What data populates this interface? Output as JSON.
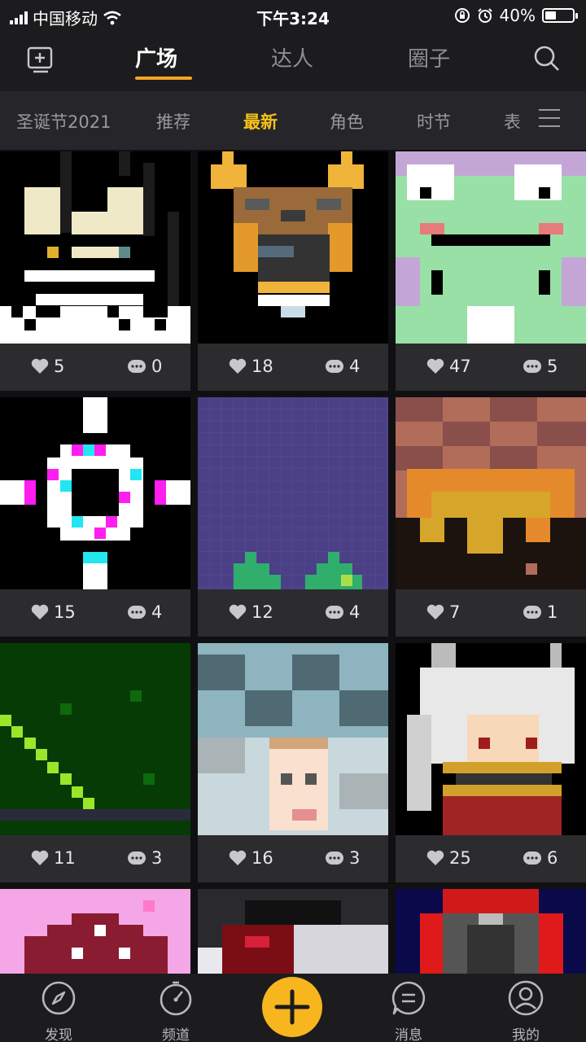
{
  "status_bar": {
    "carrier": "中国移动",
    "time": "下午3:24",
    "battery": "40%",
    "battery_level": 0.4
  },
  "top_nav": {
    "tabs": [
      {
        "label": "广场",
        "active": true
      },
      {
        "label": "达人",
        "active": false
      },
      {
        "label": "圈子",
        "active": false
      }
    ],
    "left_icon": "add-square-icon",
    "right_icon": "search-icon"
  },
  "categories": {
    "items": [
      {
        "label": "圣诞节2021",
        "active": false
      },
      {
        "label": "推荐",
        "active": false
      },
      {
        "label": "最新",
        "active": true
      },
      {
        "label": "角色",
        "active": false
      },
      {
        "label": "时节",
        "active": false
      },
      {
        "label": "表",
        "active": false
      }
    ],
    "menu_icon": "menu-lines-icon"
  },
  "posts": [
    {
      "likes": "5",
      "comments": "0",
      "art": "black-white-spikes"
    },
    {
      "likes": "18",
      "comments": "4",
      "art": "owl-with-antlers"
    },
    {
      "likes": "47",
      "comments": "5",
      "art": "green-frog"
    },
    {
      "likes": "15",
      "comments": "4",
      "art": "neon-ring-crosshair"
    },
    {
      "likes": "12",
      "comments": "4",
      "art": "purple-grid-plants"
    },
    {
      "likes": "7",
      "comments": "1",
      "art": "fire-checker"
    },
    {
      "likes": "11",
      "comments": "3",
      "art": "green-diagonal-line"
    },
    {
      "likes": "16",
      "comments": "3",
      "art": "checker-face"
    },
    {
      "likes": "25",
      "comments": "6",
      "art": "white-haired-horned-girl"
    },
    {
      "likes": "",
      "comments": "",
      "art": "pink-red-dome"
    },
    {
      "likes": "",
      "comments": "",
      "art": "dark-red-white-blob"
    },
    {
      "likes": "",
      "comments": "",
      "art": "red-helmet"
    }
  ],
  "bottom_nav": {
    "items": [
      {
        "label": "发现",
        "icon": "compass-icon"
      },
      {
        "label": "频道",
        "icon": "gauge-icon"
      },
      {
        "label": "消息",
        "icon": "message-icon"
      },
      {
        "label": "我的",
        "icon": "profile-icon"
      }
    ],
    "center_icon": "plus-icon",
    "accent": "#f7b51e"
  },
  "colors": {
    "active_category": "#f5c21b",
    "tab_underline": "#f5a623",
    "card_bg": "#2c2c2e"
  }
}
